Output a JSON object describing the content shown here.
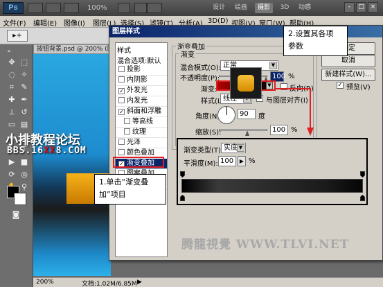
{
  "app": {
    "logo": "Ps",
    "zoom": "100%",
    "workspaces": [
      "设计",
      "绘画",
      "摄影",
      "3D",
      "动感"
    ],
    "active_workspace": "摄影",
    "window_controls": [
      "-",
      "□",
      "×"
    ]
  },
  "menubar": {
    "items": [
      "文件(F)",
      "编辑(E)",
      "图像(I)",
      "图层(L)",
      "选择(S)",
      "滤镜(T)",
      "分析(A)",
      "3D(D)",
      "视图(V)",
      "窗口(W)",
      "帮助(H)"
    ]
  },
  "options_bar": {
    "tool_glyph": "▸+"
  },
  "document": {
    "tab_title": "按钮背景.psd @ 200% (图层",
    "zoom": "200%",
    "doc_info": "文档:1.02M/6.85M"
  },
  "watermark": {
    "line1": "小排教程论坛",
    "line2_prefix": "BBS.16",
    "line2_red": "XX",
    "line2_suffix": "8.COM",
    "bottom": "腾龍視覺 WWW.TLVI.NET"
  },
  "dialog": {
    "title": "图层样式",
    "styles_header": "样式",
    "blend_options": "混合选项:默认",
    "styles": [
      {
        "label": "投影",
        "checked": false,
        "indent": false
      },
      {
        "label": "内阴影",
        "checked": false,
        "indent": false
      },
      {
        "label": "外发光",
        "checked": true,
        "indent": false
      },
      {
        "label": "内发光",
        "checked": false,
        "indent": false
      },
      {
        "label": "斜面和浮雕",
        "checked": true,
        "indent": false
      },
      {
        "label": "等高线",
        "checked": false,
        "indent": true
      },
      {
        "label": "纹理",
        "checked": false,
        "indent": true
      },
      {
        "label": "光泽",
        "checked": false,
        "indent": false
      },
      {
        "label": "颜色叠加",
        "checked": false,
        "indent": false
      },
      {
        "label": "渐变叠加",
        "checked": true,
        "indent": false,
        "selected": true
      },
      {
        "label": "图案叠加",
        "checked": false,
        "indent": false
      },
      {
        "label": "描边",
        "checked": false,
        "indent": false
      }
    ],
    "gradient_overlay": {
      "group_title": "渐变叠加",
      "subgroup_title": "渐变",
      "blend_mode_label": "混合模式(O):",
      "blend_mode_value": "正常",
      "opacity_label": "不透明度(P):",
      "opacity_value": "100",
      "opacity_unit": "%",
      "gradient_label": "渐变:",
      "reverse_label": "反向(R)",
      "style_label": "样式(L):",
      "style_value": "线性",
      "align_label": "与图层对齐(I)",
      "angle_label": "角度(N):",
      "angle_value": "90",
      "angle_unit": "度",
      "scale_label": "缩放(S):",
      "scale_value": "100",
      "scale_unit": "%"
    },
    "buttons": {
      "ok": "确定",
      "cancel": "取消",
      "new_style": "新建样式(W)...",
      "preview": "预览(V)"
    }
  },
  "gradient_editor": {
    "type_label": "渐变类型(T):",
    "type_value": "实底",
    "smooth_label": "平滑度(M):",
    "smooth_value": "100",
    "smooth_unit": "%"
  },
  "callouts": {
    "step1_line1": "1.单击“渐变叠",
    "step1_line2": "加”项目",
    "step2_line1": "2.设置其各项",
    "step2_line2": "参数"
  },
  "colors": {
    "highlight_red": "#e02020",
    "selection_blue": "#0a246a",
    "title_gradient_start": "#0a246a"
  }
}
